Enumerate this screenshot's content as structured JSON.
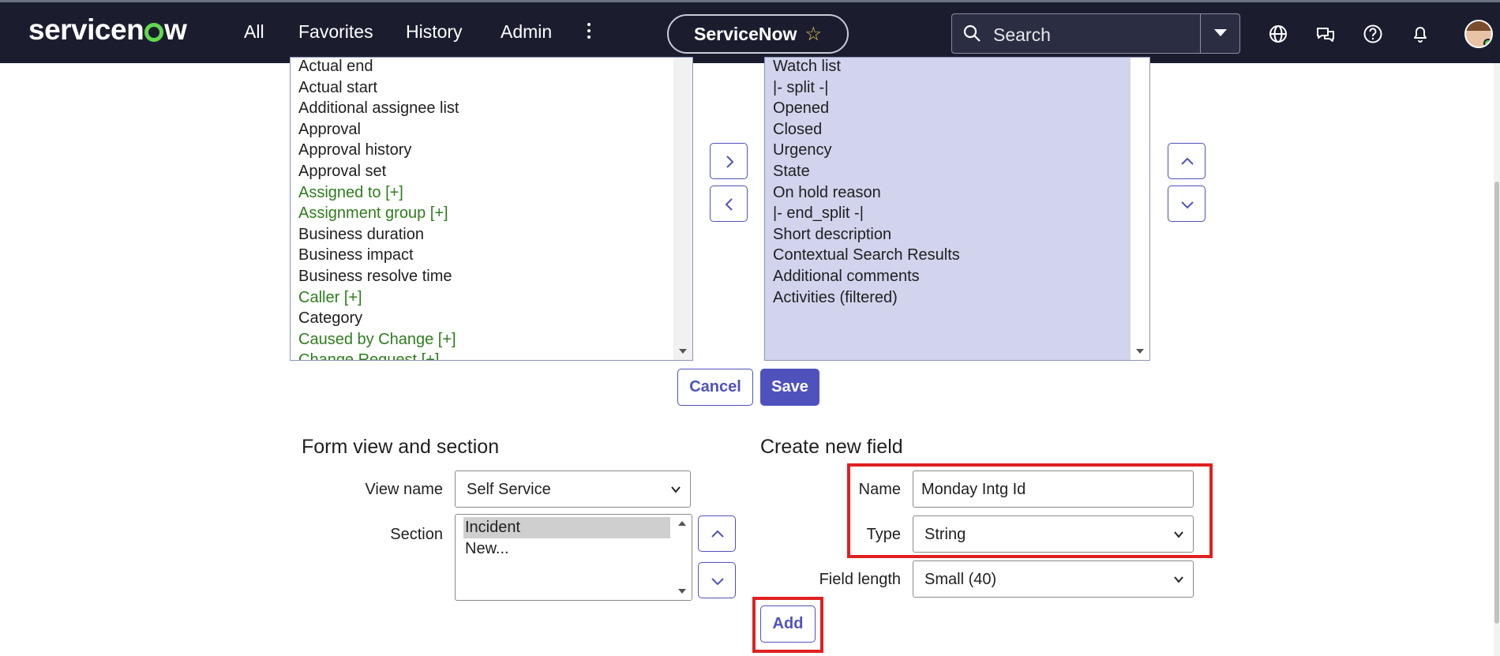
{
  "header": {
    "logo": "servicenow",
    "nav": [
      "All",
      "Favorites",
      "History",
      "Admin"
    ],
    "context_pill": "ServiceNow",
    "search_placeholder": "Search"
  },
  "available_fields": [
    {
      "label": "Actual end",
      "green": false
    },
    {
      "label": "Actual start",
      "green": false
    },
    {
      "label": "Additional assignee list",
      "green": false
    },
    {
      "label": "Approval",
      "green": false
    },
    {
      "label": "Approval history",
      "green": false
    },
    {
      "label": "Approval set",
      "green": false
    },
    {
      "label": "Assigned to [+]",
      "green": true
    },
    {
      "label": "Assignment group [+]",
      "green": true
    },
    {
      "label": "Business duration",
      "green": false
    },
    {
      "label": "Business impact",
      "green": false
    },
    {
      "label": "Business resolve time",
      "green": false
    },
    {
      "label": "Caller [+]",
      "green": true
    },
    {
      "label": "Category",
      "green": false
    },
    {
      "label": "Caused by Change [+]",
      "green": true
    },
    {
      "label": "Change Request [+]",
      "green": true
    }
  ],
  "selected_fields": [
    "Watch list",
    "|- split -|",
    "Opened",
    "Closed",
    "Urgency",
    "State",
    "On hold reason",
    "|- end_split -|",
    "Short description",
    "Contextual Search Results",
    "Additional comments",
    "Activities (filtered)"
  ],
  "actions": {
    "cancel": "Cancel",
    "save": "Save"
  },
  "form_view": {
    "heading": "Form view and section",
    "view_name_label": "View name",
    "view_name_value": "Self Service",
    "section_label": "Section",
    "sections": [
      "Incident",
      "New..."
    ]
  },
  "new_field": {
    "heading": "Create new field",
    "name_label": "Name",
    "name_value": "Monday Intg Id",
    "type_label": "Type",
    "type_value": "String",
    "length_label": "Field length",
    "length_value": "Small (40)",
    "add_label": "Add"
  },
  "colors": {
    "topbar": "#1b1d2f",
    "accent": "#4f52bd",
    "highlight": "#e02020",
    "reference_field": "#2e7d1c"
  }
}
